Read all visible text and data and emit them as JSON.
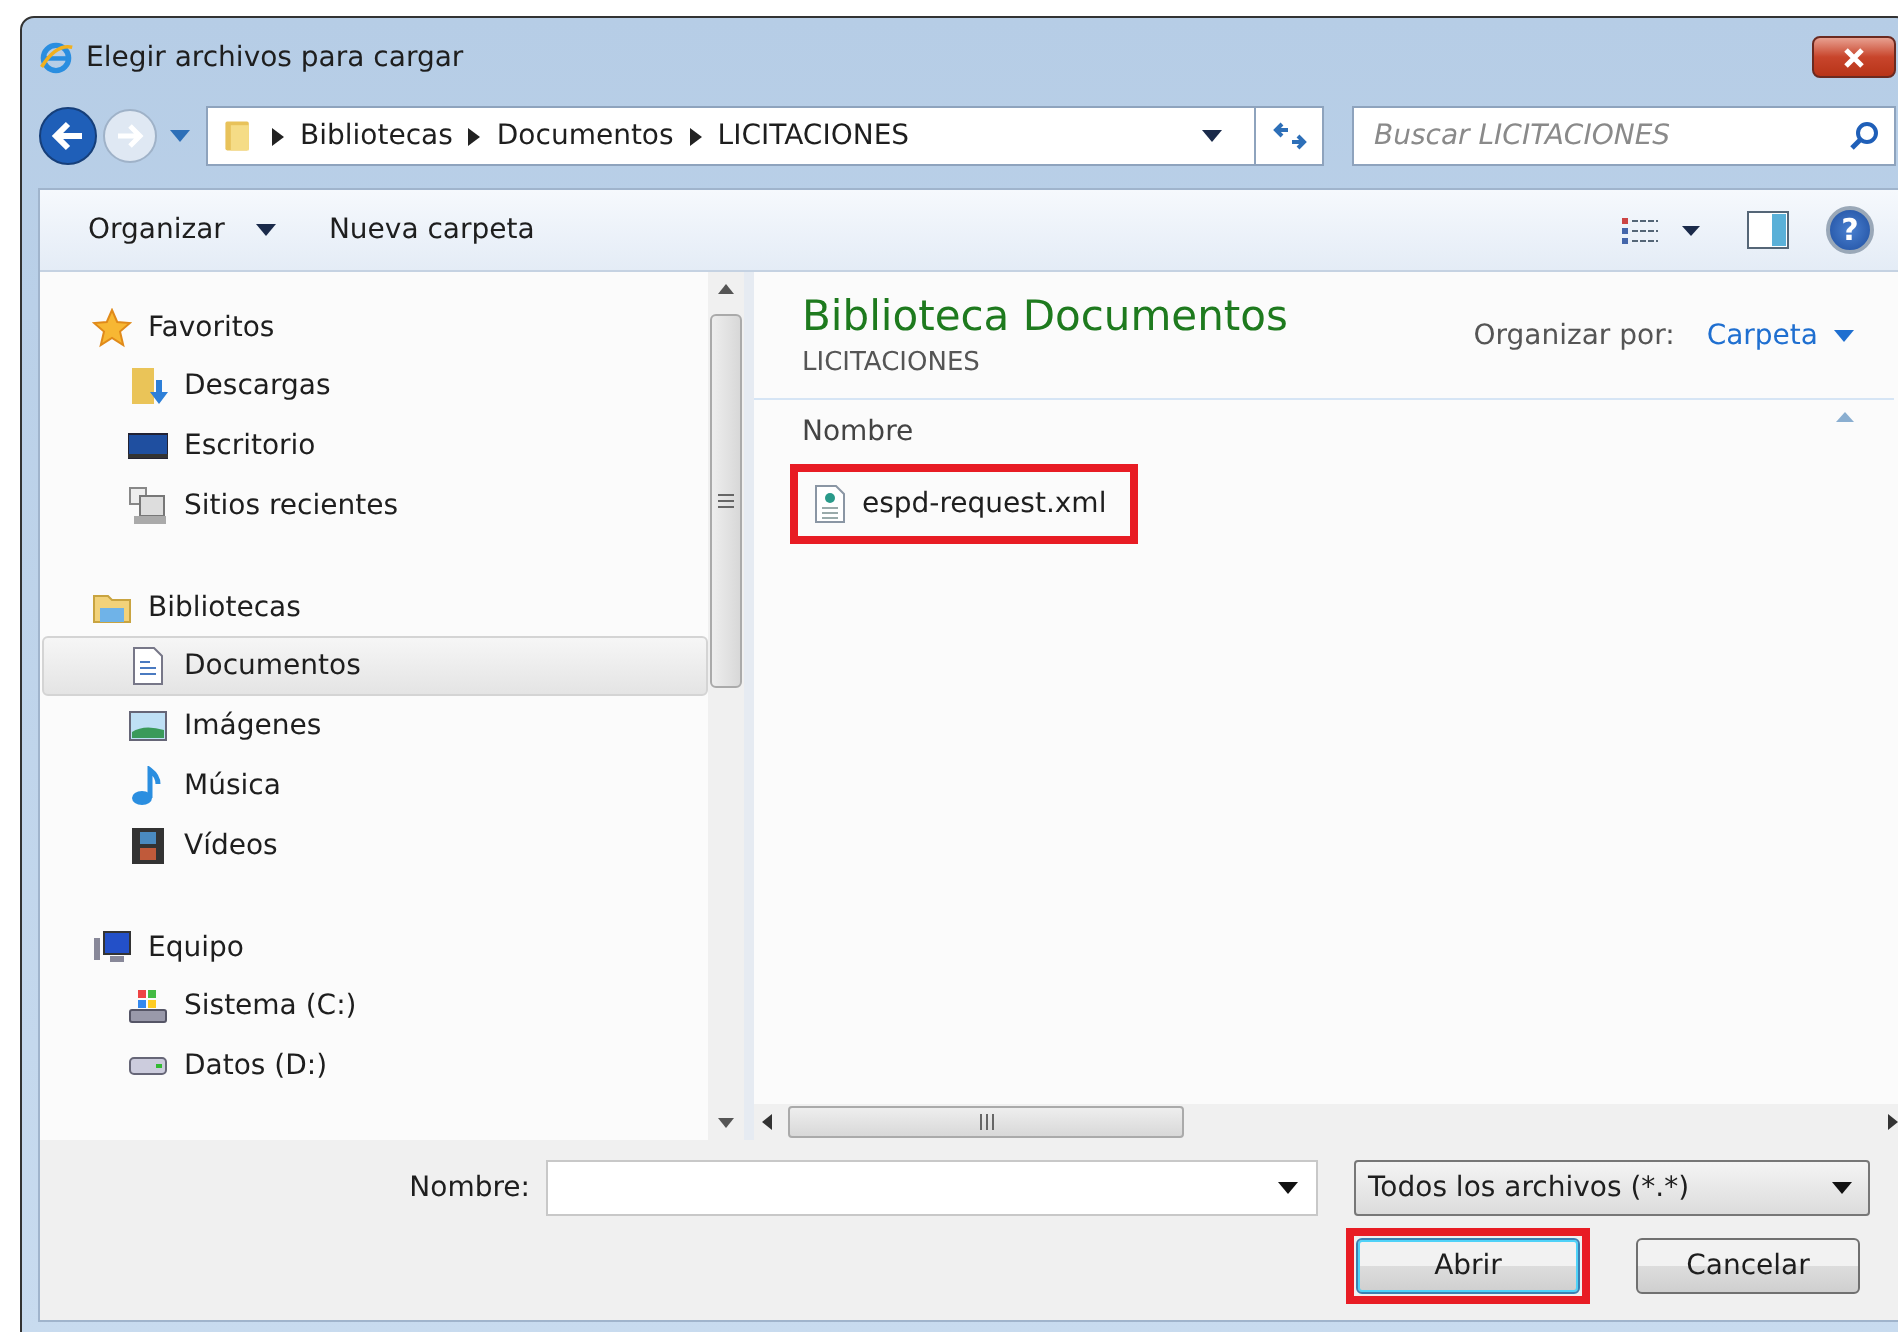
{
  "window": {
    "title": "Elegir archivos para cargar"
  },
  "address": {
    "crumbs": [
      "Bibliotecas",
      "Documentos",
      "LICITACIONES"
    ]
  },
  "search": {
    "placeholder": "Buscar LICITACIONES"
  },
  "toolbar": {
    "buttons": [
      {
        "label": "Organizar",
        "dropdown": true
      },
      {
        "label": "Nueva carpeta",
        "dropdown": false
      }
    ],
    "help": "?"
  },
  "sidebar": {
    "groups": [
      {
        "label": "Favoritos",
        "items": [
          {
            "label": "Descargas",
            "selected": false
          },
          {
            "label": "Escritorio",
            "selected": false
          },
          {
            "label": "Sitios recientes",
            "selected": false
          }
        ]
      },
      {
        "label": "Bibliotecas",
        "items": [
          {
            "label": "Documentos",
            "selected": true
          },
          {
            "label": "Imágenes",
            "selected": false
          },
          {
            "label": "Música",
            "selected": false
          },
          {
            "label": "Vídeos",
            "selected": false
          }
        ]
      },
      {
        "label": "Equipo",
        "items": [
          {
            "label": "Sistema (C:)",
            "selected": false
          },
          {
            "label": "Datos (D:)",
            "selected": false
          }
        ]
      }
    ]
  },
  "library": {
    "title": "Biblioteca Documentos",
    "subtitle": "LICITACIONES",
    "arrange_label": "Organizar por:",
    "arrange_value": "Carpeta"
  },
  "file_list": {
    "columns": [
      "Nombre"
    ],
    "files": [
      {
        "name": "espd-request.xml",
        "highlighted": true
      }
    ]
  },
  "footer": {
    "name_label": "Nombre:",
    "filter": "Todos los archivos (*.*)",
    "buttons": [
      {
        "label": "Abrir",
        "highlighted": true
      },
      {
        "label": "Cancelar",
        "highlighted": false
      }
    ]
  }
}
